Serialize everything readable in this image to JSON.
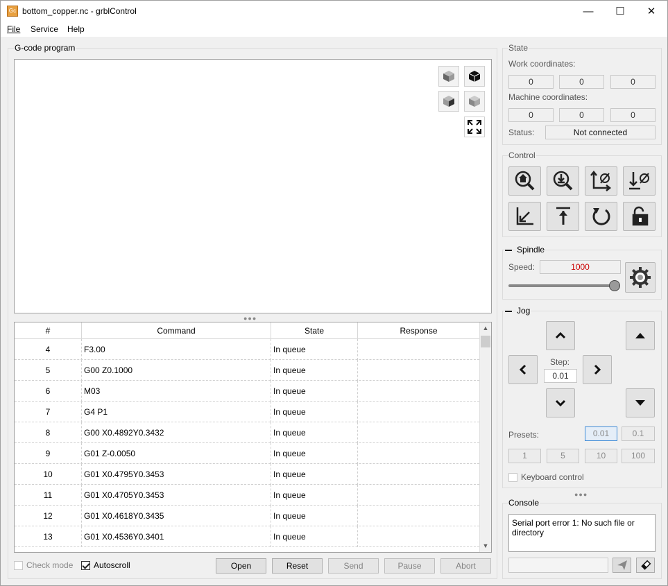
{
  "window": {
    "title": "bottom_copper.nc - grblControl",
    "icon_text": "Gc",
    "minimize": "—",
    "maximize": "☐",
    "close": "✕"
  },
  "menu": {
    "file": "File",
    "service": "Service",
    "help": "Help"
  },
  "gcode": {
    "group_title": "G-code program",
    "columns": [
      "#",
      "Command",
      "State",
      "Response"
    ],
    "rows": [
      {
        "num": "4",
        "cmd": "F3.00",
        "state": "In queue",
        "resp": ""
      },
      {
        "num": "5",
        "cmd": "G00 Z0.1000",
        "state": "In queue",
        "resp": ""
      },
      {
        "num": "6",
        "cmd": "M03",
        "state": "In queue",
        "resp": ""
      },
      {
        "num": "7",
        "cmd": "G4 P1",
        "state": "In queue",
        "resp": ""
      },
      {
        "num": "8",
        "cmd": "G00 X0.4892Y0.3432",
        "state": "In queue",
        "resp": ""
      },
      {
        "num": "9",
        "cmd": "G01 Z-0.0050",
        "state": "In queue",
        "resp": ""
      },
      {
        "num": "10",
        "cmd": "G01 X0.4795Y0.3453",
        "state": "In queue",
        "resp": ""
      },
      {
        "num": "11",
        "cmd": "G01 X0.4705Y0.3453",
        "state": "In queue",
        "resp": ""
      },
      {
        "num": "12",
        "cmd": "G01 X0.4618Y0.3435",
        "state": "In queue",
        "resp": ""
      },
      {
        "num": "13",
        "cmd": "G01 X0.4536Y0.3401",
        "state": "In queue",
        "resp": ""
      }
    ],
    "check_mode": "Check mode",
    "check_mode_checked": false,
    "autoscroll": "Autoscroll",
    "autoscroll_checked": true,
    "buttons": {
      "open": "Open",
      "reset": "Reset",
      "send": "Send",
      "pause": "Pause",
      "abort": "Abort"
    }
  },
  "state": {
    "group_title": "State",
    "work_label": "Work coordinates:",
    "work": [
      "0",
      "0",
      "0"
    ],
    "machine_label": "Machine coordinates:",
    "machine": [
      "0",
      "0",
      "0"
    ],
    "status_label": "Status:",
    "status_value": "Not connected"
  },
  "control": {
    "group_title": "Control",
    "buttons": [
      "home-icon",
      "z-probe-icon",
      "zero-xy-icon",
      "zero-z-icon",
      "return-xy-icon",
      "safe-position-icon",
      "reset-icon",
      "unlock-icon"
    ]
  },
  "spindle": {
    "group_title": "Spindle",
    "speed_label": "Speed:",
    "speed_value": "1000",
    "speed_color": "#cc0000",
    "slider_level": 1.0
  },
  "jog": {
    "group_title": "Jog",
    "step_label": "Step:",
    "step_value": "0.01",
    "presets_label": "Presets:",
    "presets": [
      "0.01",
      "0.1",
      "1",
      "5",
      "10",
      "100"
    ],
    "selected_preset": "0.01",
    "keyboard_control": "Keyboard control",
    "keyboard_checked": false
  },
  "console": {
    "group_title": "Console",
    "output": "Serial port error 1: No such file or directory",
    "input_value": ""
  }
}
